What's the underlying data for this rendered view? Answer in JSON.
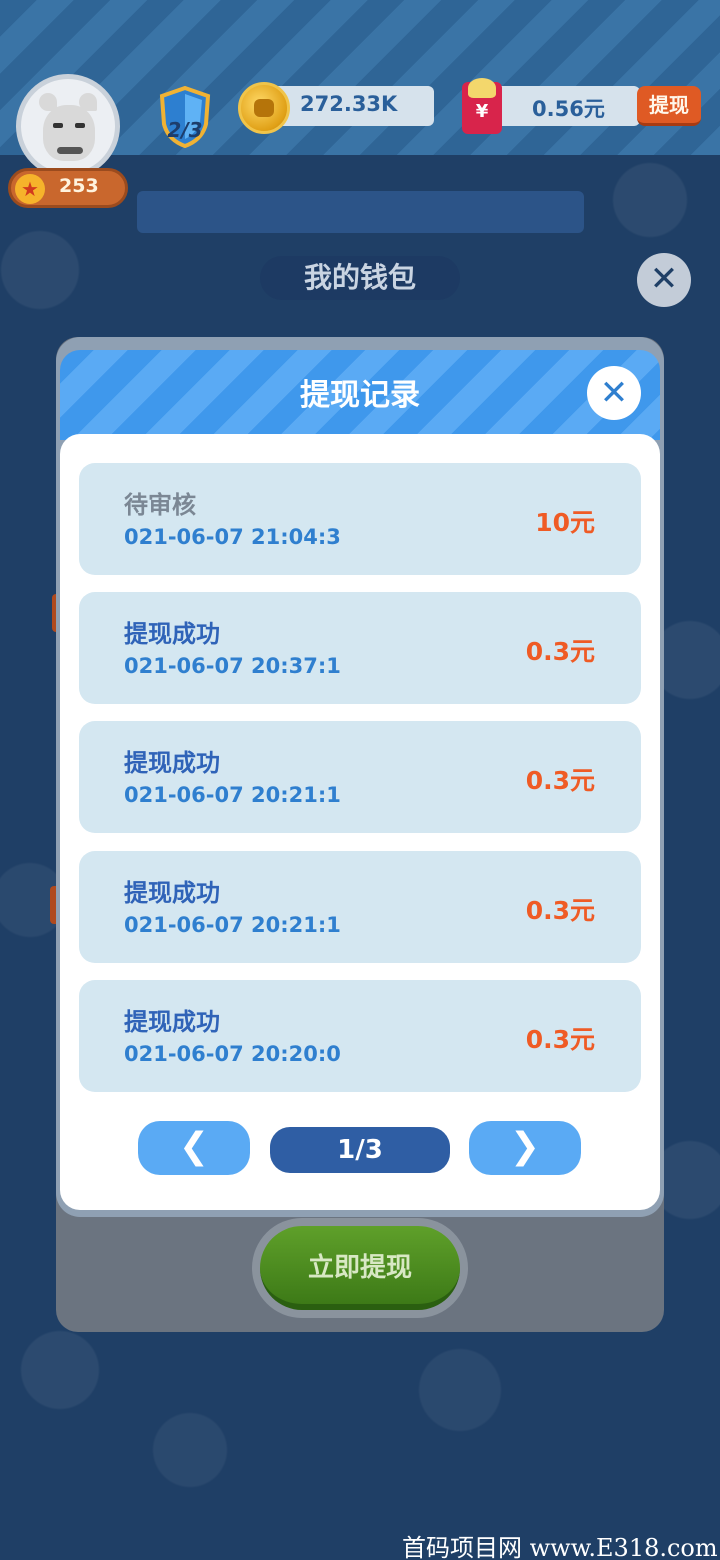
{
  "header": {
    "level": "253",
    "shield_progress": "2/3",
    "coins": "272.33K",
    "cash": "0.56元",
    "withdraw_label": "提现"
  },
  "wallet": {
    "title": "我的钱包",
    "close_icon": "close-icon",
    "withdraw_now_label": "立即提现"
  },
  "modal": {
    "title": "提现记录",
    "records": [
      {
        "status": "待审核",
        "time": "021-06-07 21:04:3",
        "amount": "10元"
      },
      {
        "status": "提现成功",
        "time": "021-06-07 20:37:1",
        "amount": "0.3元"
      },
      {
        "status": "提现成功",
        "time": "021-06-07 20:21:1",
        "amount": "0.3元"
      },
      {
        "status": "提现成功",
        "time": "021-06-07 20:21:1",
        "amount": "0.3元"
      },
      {
        "status": "提现成功",
        "time": "021-06-07 20:20:0",
        "amount": "0.3元"
      }
    ],
    "pager": {
      "page": "1/3",
      "prev_icon": "chevron-left-icon",
      "next_icon": "chevron-right-icon"
    }
  },
  "watermark": "首码项目网 www.E318.com",
  "colors": {
    "accent_blue": "#5aaaf4",
    "amount_orange": "#ef5b25",
    "record_bg": "#d4e7f1"
  }
}
